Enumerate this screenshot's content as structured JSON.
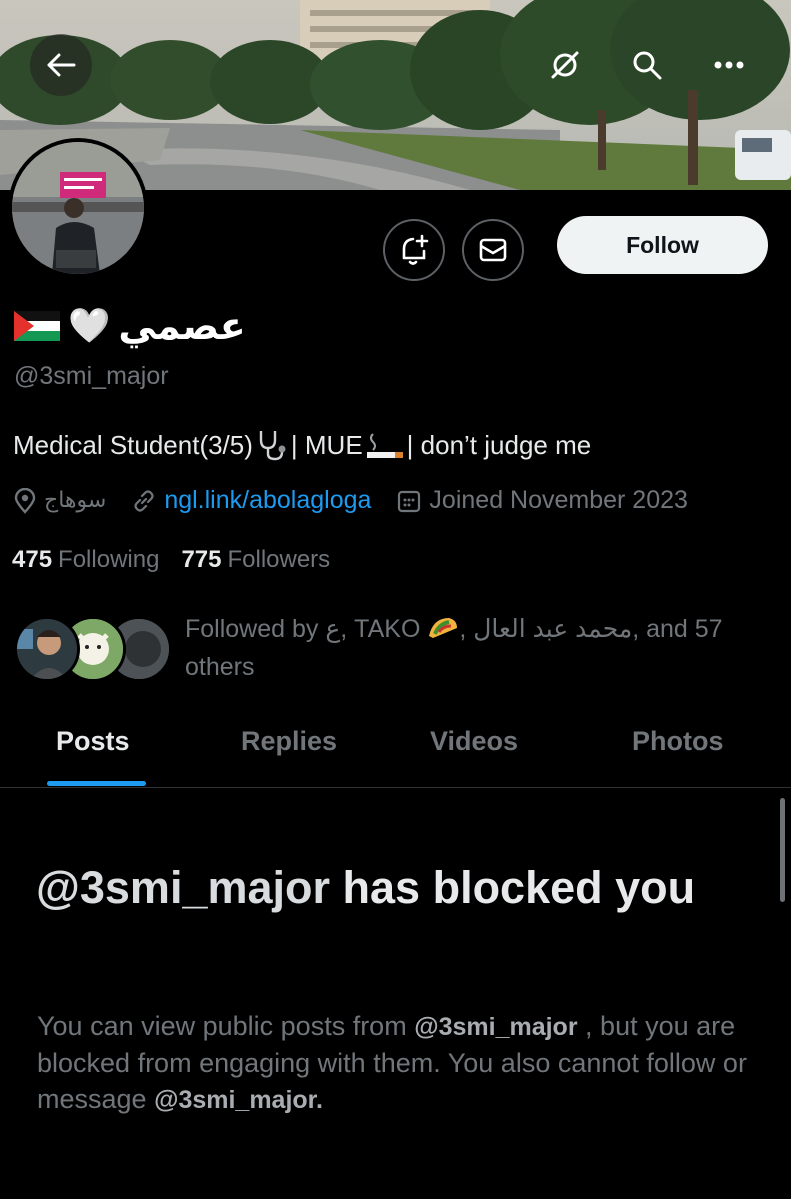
{
  "banner": {
    "back_icon": "arrow-left-icon",
    "grok_icon": "grok-icon",
    "search_icon": "search-icon",
    "more_icon": "more-icon"
  },
  "actions": {
    "notify_icon": "bell-plus-icon",
    "message_icon": "envelope-icon",
    "follow_label": "Follow"
  },
  "profile": {
    "name": "عصمي",
    "name_emoji": "🤍",
    "handle": "@3smi_major",
    "bio_part1": "Medical Student(3/5) ",
    "bio_part2": "| MUE ",
    "bio_part3": "| don’t judge me",
    "location": "سوهاج",
    "link": "ngl.link/abolagloga",
    "joined": "Joined November 2023",
    "following_count": "475",
    "following_label": "Following",
    "followers_count": "775",
    "followers_label": "Followers",
    "followed_by_part1": "Followed by ع, TAKO ",
    "followed_by_part2": ", محمد عبد العال, and 57 others"
  },
  "tabs": [
    {
      "label": "Posts",
      "active": true
    },
    {
      "label": "Replies",
      "active": false
    },
    {
      "label": "Videos",
      "active": false
    },
    {
      "label": "Photos",
      "active": false
    }
  ],
  "blocked": {
    "handle": "@3smi_major",
    "title_rest": " has blocked you",
    "desc_part1": "You can view public posts from ",
    "desc_handle1": "@3smi_major",
    "desc_part2": " , but you are blocked from engaging with them. You also cannot follow or message ",
    "desc_handle2": "@3smi_major."
  },
  "colors": {
    "accent": "#1d9bf0",
    "secondary_text": "#71767b",
    "primary_text": "#e7e9ea",
    "background": "#000000"
  }
}
